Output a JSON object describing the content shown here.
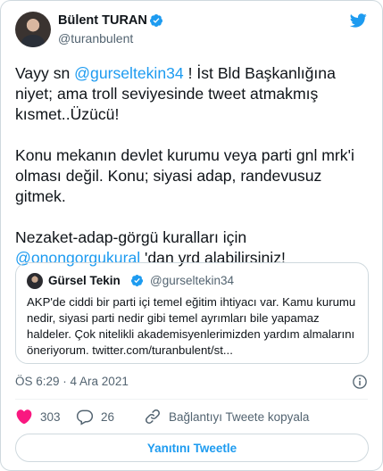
{
  "author": {
    "name": "Bülent TURAN",
    "handle": "@turanbulent"
  },
  "tweet": {
    "para1_prefix": "Vayy sn ",
    "para1_mention": "@gurseltekin34",
    "para1_suffix": " ! İst Bld Başkanlığına niyet; ama troll seviyesinde tweet atmakmış kısmet..Üzücü!",
    "para2": "Konu mekanın devlet kurumu veya parti gnl mrk'i olması değil. Konu; siyasi adap, randevusuz gitmek.",
    "para3_prefix": "Nezaket-adap-görgü kuralları için ",
    "para3_mention": "@onongorgukural",
    "para3_suffix": " 'dan yrd alabilirsiniz!"
  },
  "quote": {
    "name": "Gürsel Tekin",
    "handle": "@gurseltekin34",
    "text": "AKP'de ciddi bir parti içi temel eğitim ihtiyacı var. Kamu kurumu nedir, siyasi parti nedir gibi temel ayrımları bile yapamaz haldeler. Çok nitelikli akademisyenlerimizden yardım almalarını öneriyorum. twitter.com/turanbulent/st..."
  },
  "meta": {
    "timestamp": "ÖS 6:29 · 4 Ara 2021"
  },
  "actions": {
    "likes": "303",
    "replies": "26",
    "copy_link": "Bağlantıyı Tweete kopyala"
  },
  "reply_button": "Yanıtını Tweetle",
  "colors": {
    "accent": "#1d9bf0",
    "like": "#f91880",
    "text": "#0f1419",
    "secondary": "#536471"
  },
  "icons": [
    "verified-badge-icon",
    "twitter-bird-icon",
    "info-icon",
    "heart-icon",
    "reply-bubble-icon",
    "link-icon"
  ]
}
